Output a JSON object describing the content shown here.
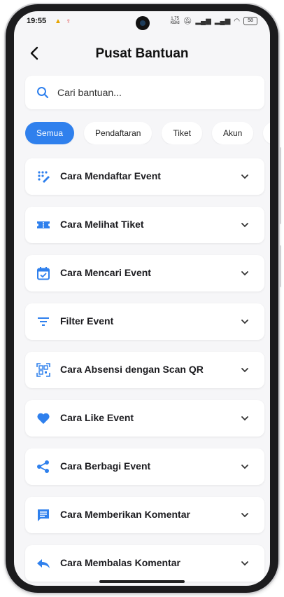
{
  "status_bar": {
    "time": "19:55",
    "net_speed_value": "1,75",
    "net_speed_unit": "KB/d",
    "battery": "58"
  },
  "header": {
    "title": "Pusat Bantuan"
  },
  "search": {
    "placeholder": "Cari bantuan..."
  },
  "categories": [
    "Semua",
    "Pendaftaran",
    "Tiket",
    "Akun",
    "E"
  ],
  "faq": [
    {
      "label": "Cara Mendaftar Event",
      "icon": "register-icon"
    },
    {
      "label": "Cara Melihat Tiket",
      "icon": "ticket-icon"
    },
    {
      "label": "Cara Mencari Event",
      "icon": "calendar-check-icon"
    },
    {
      "label": "Filter Event",
      "icon": "filter-icon"
    },
    {
      "label": "Cara Absensi dengan Scan QR",
      "icon": "qr-scan-icon"
    },
    {
      "label": "Cara Like Event",
      "icon": "heart-icon"
    },
    {
      "label": "Cara Berbagi Event",
      "icon": "share-icon"
    },
    {
      "label": "Cara Memberikan Komentar",
      "icon": "comment-icon"
    },
    {
      "label": "Cara Membalas Komentar",
      "icon": "reply-icon"
    }
  ],
  "colors": {
    "accent": "#2f80ed",
    "background": "#f6f6f8",
    "card": "#ffffff"
  }
}
